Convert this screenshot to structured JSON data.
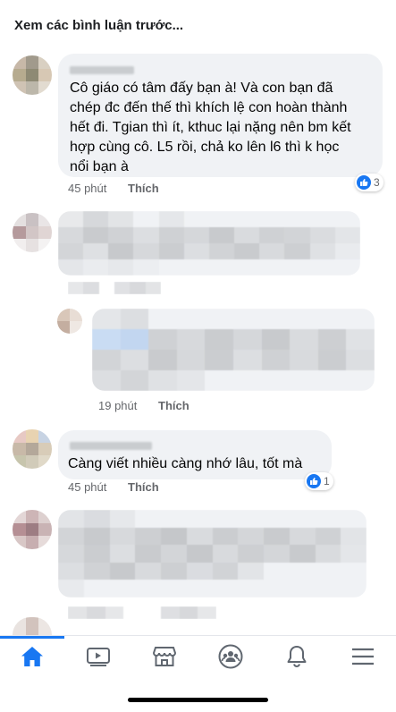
{
  "view_previous": "Xem các bình luận trước...",
  "comments": [
    {
      "text": "Cô giáo có tâm đấy bạn à! Và con bạn đã\nchép đc đến thế thì khích lệ con hoàn thành\nhết đi. Tgian thì ít, kthuc lại nặng nên bm kết\nhợp cùng cô. L5 rồi, chả ko lên l6 thì k học\nnổi bạn à",
      "time": "45 phút",
      "like_label": "Thích",
      "reactions": "3"
    },
    {
      "time": "19 phút",
      "like_label": "Thích"
    },
    {
      "text": "Càng viết nhiều càng nhớ lâu, tốt mà",
      "time": "45 phút",
      "like_label": "Thích",
      "reactions": "1"
    }
  ],
  "tabs": [
    "home-icon",
    "watch-icon",
    "marketplace-icon",
    "groups-icon",
    "notifications-icon",
    "menu-icon"
  ],
  "colors": {
    "accent": "#1877f2",
    "bubble": "#f0f2f5",
    "meta": "#65676b"
  }
}
